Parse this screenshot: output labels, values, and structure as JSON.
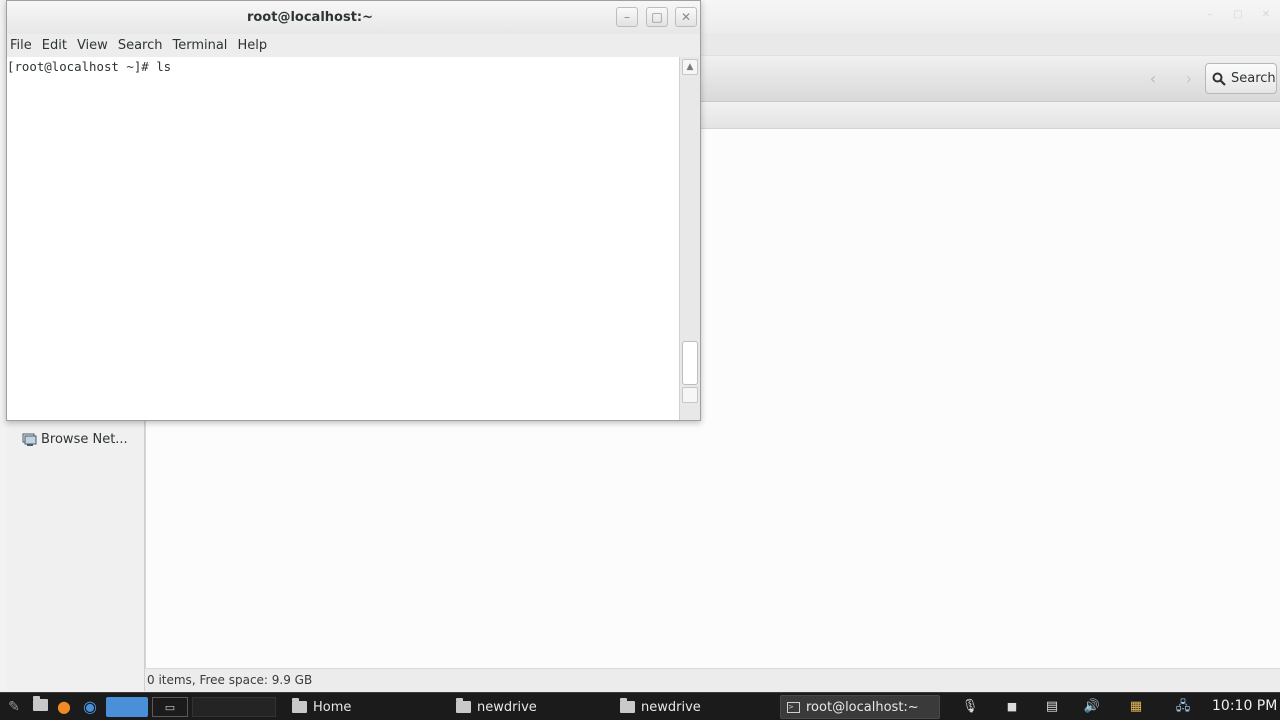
{
  "colors": {
    "accent": "#4a90d9",
    "taskbar": "#1b1b1b",
    "terminal_bg": "#ffffff"
  },
  "terminal": {
    "title": "root@localhost:~",
    "menu": [
      "File",
      "Edit",
      "View",
      "Search",
      "Terminal",
      "Help"
    ],
    "prompt_line": "[root@localhost ~]# ls"
  },
  "file_manager": {
    "search_label": "Search",
    "sidebar_item": "Browse Net...",
    "status": "0 items, Free space: 9.9 GB"
  },
  "taskbar": {
    "tasks": [
      "Home",
      "newdrive",
      "newdrive",
      "root@localhost:~"
    ],
    "clock": "10:10 PM"
  },
  "icons": {
    "search": "magnifier-icon",
    "back": "arrow-left-icon",
    "forward": "arrow-right-icon",
    "network": "network-icon",
    "minimize": "minimize-icon",
    "maximize": "maximize-icon",
    "close": "close-icon"
  }
}
